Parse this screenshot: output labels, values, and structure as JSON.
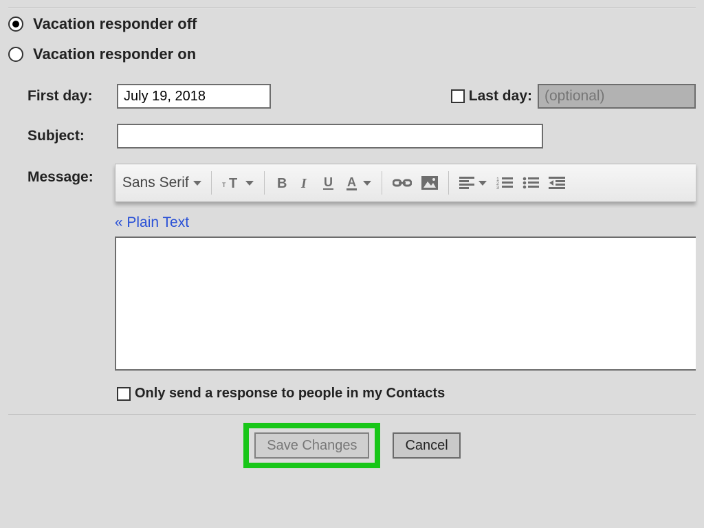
{
  "radios": {
    "off_label": "Vacation responder off",
    "on_label": "Vacation responder on",
    "selected": "off"
  },
  "fields": {
    "first_day_label": "First day:",
    "first_day_value": "July 19, 2018",
    "last_day_label": "Last day:",
    "last_day_placeholder": "(optional)",
    "subject_label": "Subject:",
    "subject_value": "",
    "message_label": "Message:"
  },
  "toolbar": {
    "font_family": "Sans Serif"
  },
  "links": {
    "plain_text": "« Plain Text"
  },
  "checkboxes": {
    "contacts_only_label": "Only send a response to people in my Contacts",
    "last_day_checked": false,
    "contacts_only_checked": false
  },
  "buttons": {
    "save": "Save Changes",
    "cancel": "Cancel"
  }
}
